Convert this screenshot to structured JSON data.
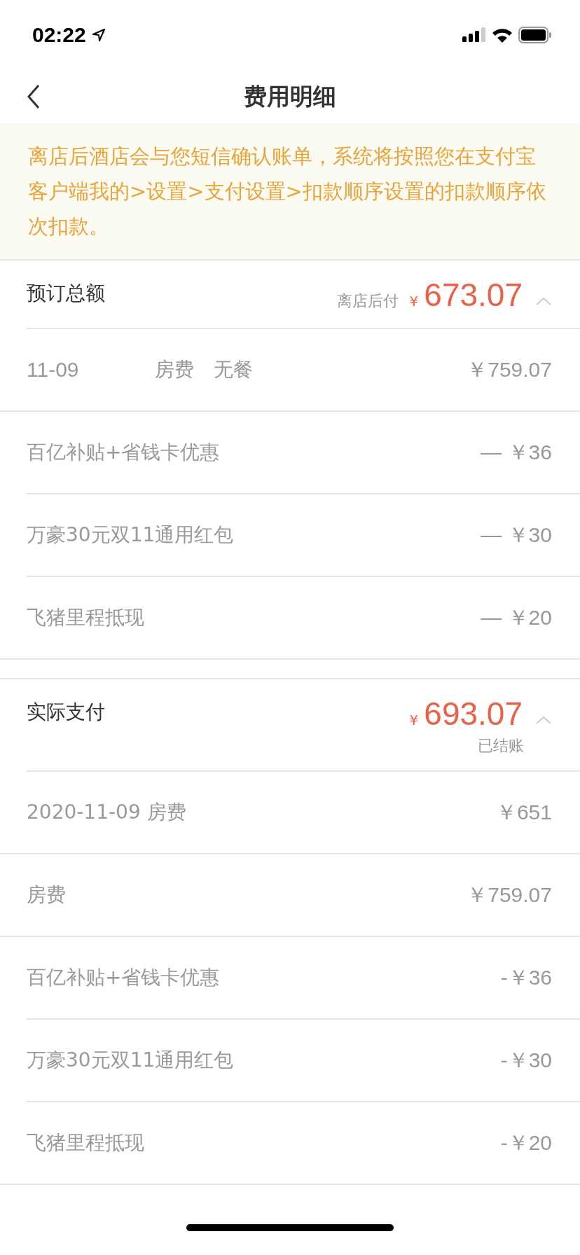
{
  "status_bar": {
    "time": "02:22"
  },
  "nav": {
    "title": "费用明细"
  },
  "notice": "离店后酒店会与您短信确认账单，系统将按照您在支付宝客户端我的>设置>支付设置>扣款顺序设置的扣款顺序依次扣款。",
  "sections": [
    {
      "label": "预订总额",
      "note": "离店后付",
      "currency": "¥",
      "amount": "673.07",
      "expanded": true,
      "rows": [
        {
          "kind": "charge",
          "date": "11-09",
          "texts": [
            "房费",
            "无餐"
          ],
          "amount": "￥759.07"
        },
        {
          "kind": "discount",
          "texts": [
            "百亿补贴+省钱卡优惠"
          ],
          "amount": "— ￥36"
        },
        {
          "kind": "discount",
          "texts": [
            "万豪30元双11通用红包"
          ],
          "amount": "— ￥30"
        },
        {
          "kind": "discount",
          "texts": [
            "飞猪里程抵现"
          ],
          "amount": "— ￥20"
        }
      ]
    },
    {
      "label": "实际支付",
      "currency": "¥",
      "amount": "693.07",
      "status": "已结账",
      "expanded": true,
      "rows": [
        {
          "kind": "charge",
          "texts": [
            "2020-11-09 房费"
          ],
          "amount": "￥651"
        },
        {
          "kind": "charge",
          "texts": [
            "房费"
          ],
          "amount": "￥759.07"
        },
        {
          "kind": "discount",
          "texts": [
            "百亿补贴+省钱卡优惠"
          ],
          "amount": "-￥36"
        },
        {
          "kind": "discount",
          "texts": [
            "万豪30元双11通用红包"
          ],
          "amount": "-￥30"
        },
        {
          "kind": "discount",
          "texts": [
            "飞猪里程抵现"
          ],
          "amount": "-￥20"
        }
      ]
    }
  ]
}
